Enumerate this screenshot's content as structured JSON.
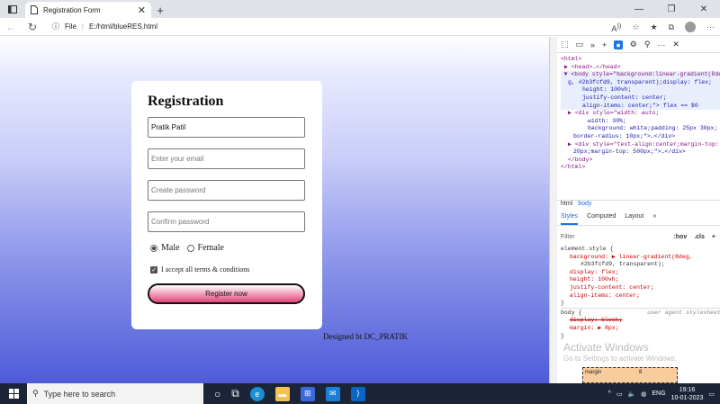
{
  "browser": {
    "tab_title": "Registration Form",
    "url_label": "File",
    "url": "E:/html/blueRES.html"
  },
  "form": {
    "heading": "Registration",
    "name_value": "Pratik Patil",
    "email_placeholder": "Enter your email",
    "password_placeholder": "Create password",
    "confirm_placeholder": "Confirm password",
    "gender_male": "Male",
    "gender_female": "Female",
    "terms_label": "I accept all terms & conditions",
    "submit_label": "Register now",
    "footer": "Designed bt DC_PRATIK"
  },
  "devtools": {
    "dom_lines": [
      "<html>",
      "▶ <head>…</head>",
      "··· ▼ <body style=\"background:linear-gradient(8de",
      "g, #2b3fcfd9, transparent);display: flex;",
      "height: 100vh;",
      "justify-content: center;",
      "align-items: center;\"> flex == $0",
      "▶ <div style=\"width: auto;",
      "width: 30%;",
      "background: white;padding: 25px 30px;",
      "border-radius: 10px;\">…</div>",
      "▶ <div style=\"text-align:center;margin-top:",
      "20px;margin-top: 500px;\">…</div>",
      "</body>",
      "</html>"
    ],
    "crumb_html": "html",
    "crumb_body": "body",
    "tab_styles": "Styles",
    "tab_computed": "Computed",
    "tab_layout": "Layout",
    "filter_placeholder": "Filter",
    "filter_hov": ":hov",
    "filter_cls": ".cls",
    "styles_lines": [
      "element.style {",
      "background: ▶ linear-gradient(8deg,",
      "#2b3fcfd9, transparent);",
      "display: flex;",
      "height: 100vh;",
      "justify-content: center;",
      "align-items: center;",
      "}",
      "body {",
      "display: block;",
      "margin: ▶ 8px;",
      "}"
    ],
    "ua_label": "user agent stylesheet",
    "activate_title": "Activate Windows",
    "activate_sub": "Go to Settings to activate Windows.",
    "box_margin": "margin",
    "box_value": "8"
  },
  "taskbar": {
    "search_placeholder": "Type here to search",
    "lang": "ENG",
    "time": "19:16",
    "date": "10-01-2023"
  },
  "colors": {
    "gradient_blue": "#2b3fcf",
    "button_pink": "#e0457a"
  }
}
